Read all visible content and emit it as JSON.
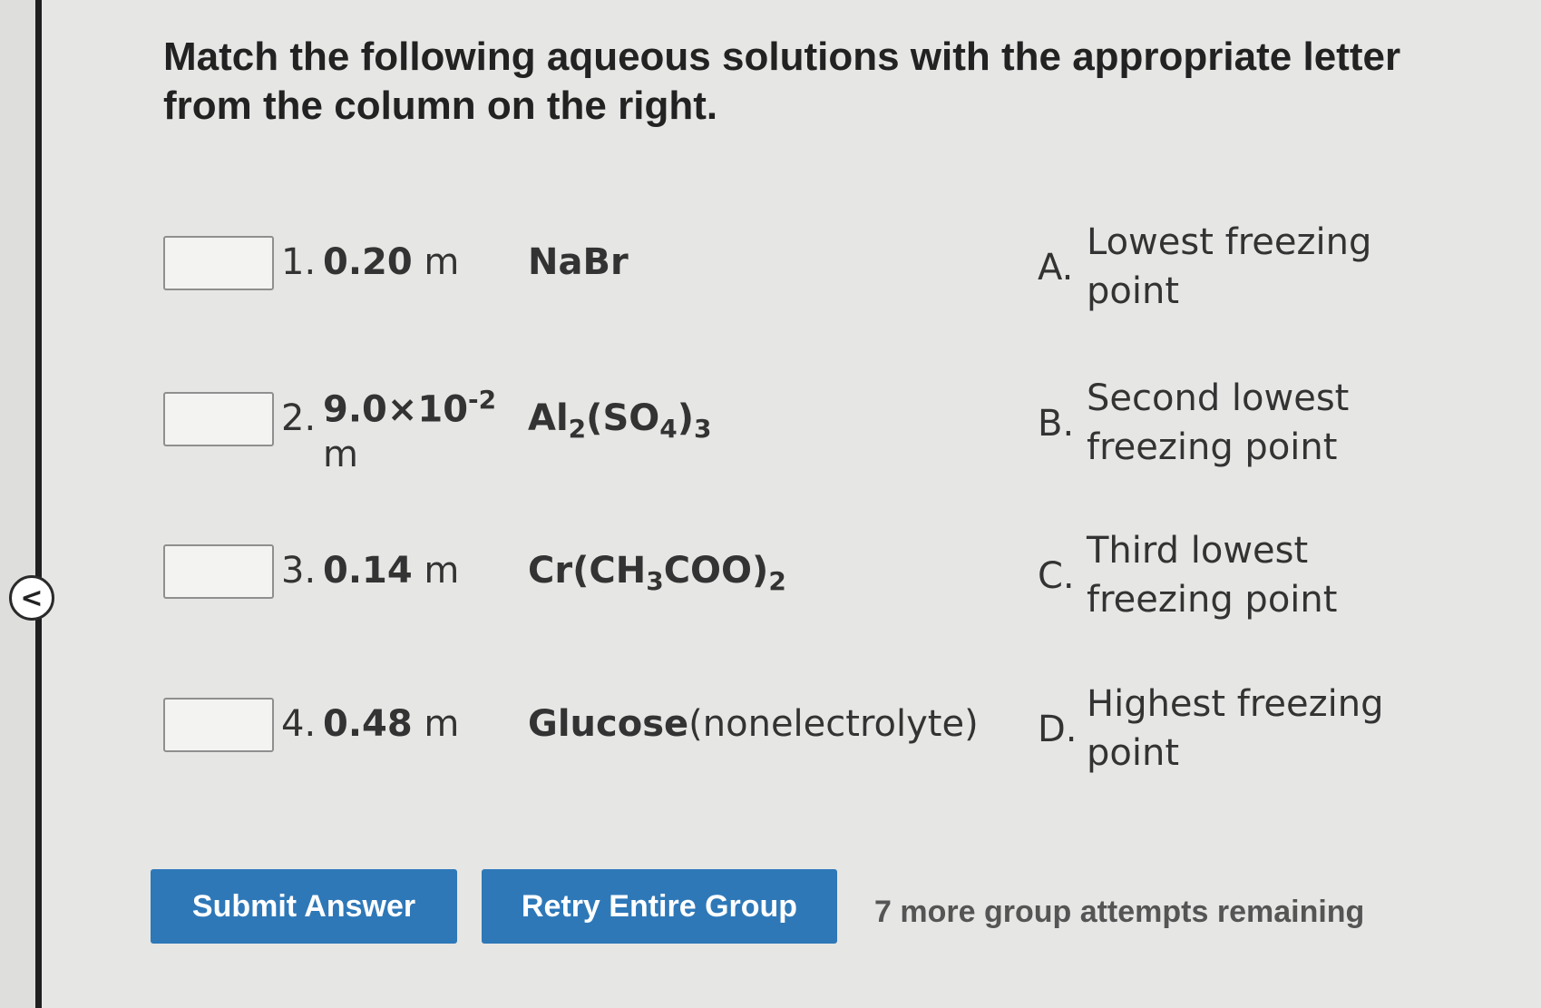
{
  "nav": {
    "back_icon": "<"
  },
  "question": {
    "prompt": "Match the following aqueous solutions with the appropriate letter from the column on the right."
  },
  "items": [
    {
      "number": "1.",
      "conc_value": "0.20",
      "conc_unit": "m",
      "compound": "NaBr"
    },
    {
      "number": "2.",
      "conc_value": "9.0×10",
      "conc_exp": "-2",
      "conc_unit": "m",
      "compound": "Al2(SO4)3"
    },
    {
      "number": "3.",
      "conc_value": "0.14",
      "conc_unit": "m",
      "compound": "Cr(CH3COO)2"
    },
    {
      "number": "4.",
      "conc_value": "0.48",
      "conc_unit": "m",
      "compound": "Glucose",
      "compound_note": "(nonelectrolyte)"
    }
  ],
  "options": [
    {
      "letter": "A.",
      "text": "Lowest freezing point"
    },
    {
      "letter": "B.",
      "text": "Second lowest freezing point"
    },
    {
      "letter": "C.",
      "text": "Third lowest freezing point"
    },
    {
      "letter": "D.",
      "text": "Highest freezing point"
    }
  ],
  "actions": {
    "submit_label": "Submit Answer",
    "retry_label": "Retry Entire Group",
    "attempts_text": "7 more group attempts remaining"
  },
  "colors": {
    "button": "#2e78b8",
    "background": "#e6e6e4"
  }
}
